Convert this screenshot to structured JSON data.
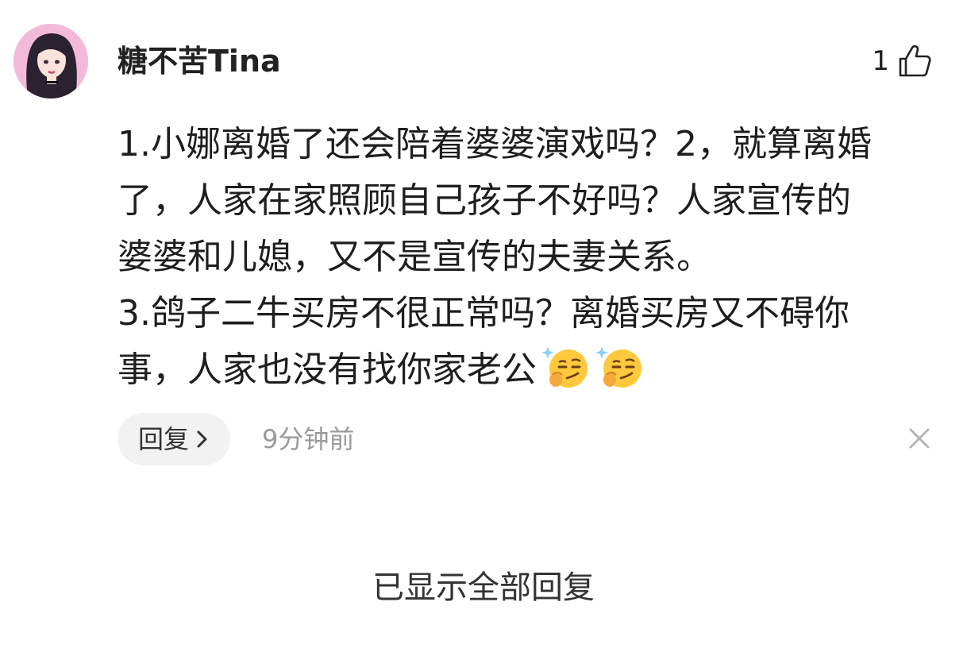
{
  "comment": {
    "username": "糖不苦Tina",
    "like_count": "1",
    "body_lines": [
      "1.小娜离婚了还会陪着婆婆演戏吗？2，就算离婚",
      "了，人家在家照顾自己孩子不好吗？人家宣传的",
      "婆婆和儿媳，又不是宣传的夫妻关系。",
      "3.鸽子二牛买房不很正常吗？离婚买房又不碍你",
      "事，人家也没有找你家老公"
    ],
    "emojis": [
      "smirk-emoji",
      "smirk-emoji"
    ],
    "reply_label": "回复",
    "timestamp": "9分钟前"
  },
  "footer": {
    "all_replies_shown": "已显示全部回复"
  },
  "colors": {
    "avatar_bg": "#f3b9d9",
    "reply_bg": "#f2f2f2",
    "muted_text": "#9a9a9a",
    "emoji_yellow": "#ffc83d"
  }
}
